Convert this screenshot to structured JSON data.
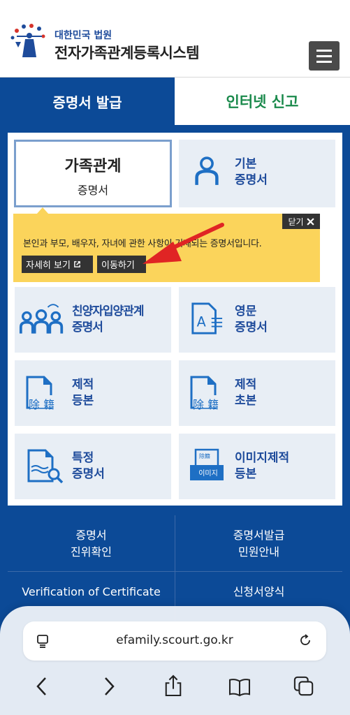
{
  "header": {
    "org_name": "대한민국 법원",
    "site_title": "전자가족관계등록시스템"
  },
  "tabs": [
    {
      "label": "증명서 발급",
      "active": true
    },
    {
      "label": "인터넷 신고",
      "active": false
    }
  ],
  "cards": {
    "family": {
      "line1": "가족관계",
      "line2": "증명서"
    },
    "basic": {
      "line1": "기본",
      "line2": "증명서"
    },
    "adoption": {
      "line1": "친양자입양관계",
      "line2": "증명서"
    },
    "english": {
      "line1": "영문",
      "line2": "증명서"
    },
    "removed_copy": {
      "line1": "제적",
      "line2": "등본"
    },
    "removed_extract": {
      "line1": "제적",
      "line2": "초본"
    },
    "special": {
      "line1": "특정",
      "line2": "증명서"
    },
    "image_removed": {
      "line1": "이미지제적",
      "line2": "등본"
    }
  },
  "tooltip": {
    "close_label": "닫기",
    "description": "본인과 부모, 배우자, 자녀에 관한 사항이 기재되는 증명서입니다.",
    "detail_button": "자세히 보기",
    "move_button": "이동하기"
  },
  "icons": {
    "removed_chars": "除 籍",
    "image_badge_top": "除籍",
    "image_badge": "이미지"
  },
  "bottom_menu": [
    {
      "line1": "증명서",
      "line2": "진위확인"
    },
    {
      "line1": "증명서발급",
      "line2": "민원안내"
    },
    {
      "line1": "Verification of Certificate",
      "line2": ""
    },
    {
      "line1": "신청서양식",
      "line2": ""
    }
  ],
  "safari": {
    "url": "efamily.scourt.go.kr"
  },
  "colors": {
    "primary_blue": "#0c4a97",
    "card_bg": "#e8eef5",
    "tooltip_yellow": "#fbd45b",
    "green_tab": "#1b8a4c",
    "arrow_red": "#e02424"
  }
}
